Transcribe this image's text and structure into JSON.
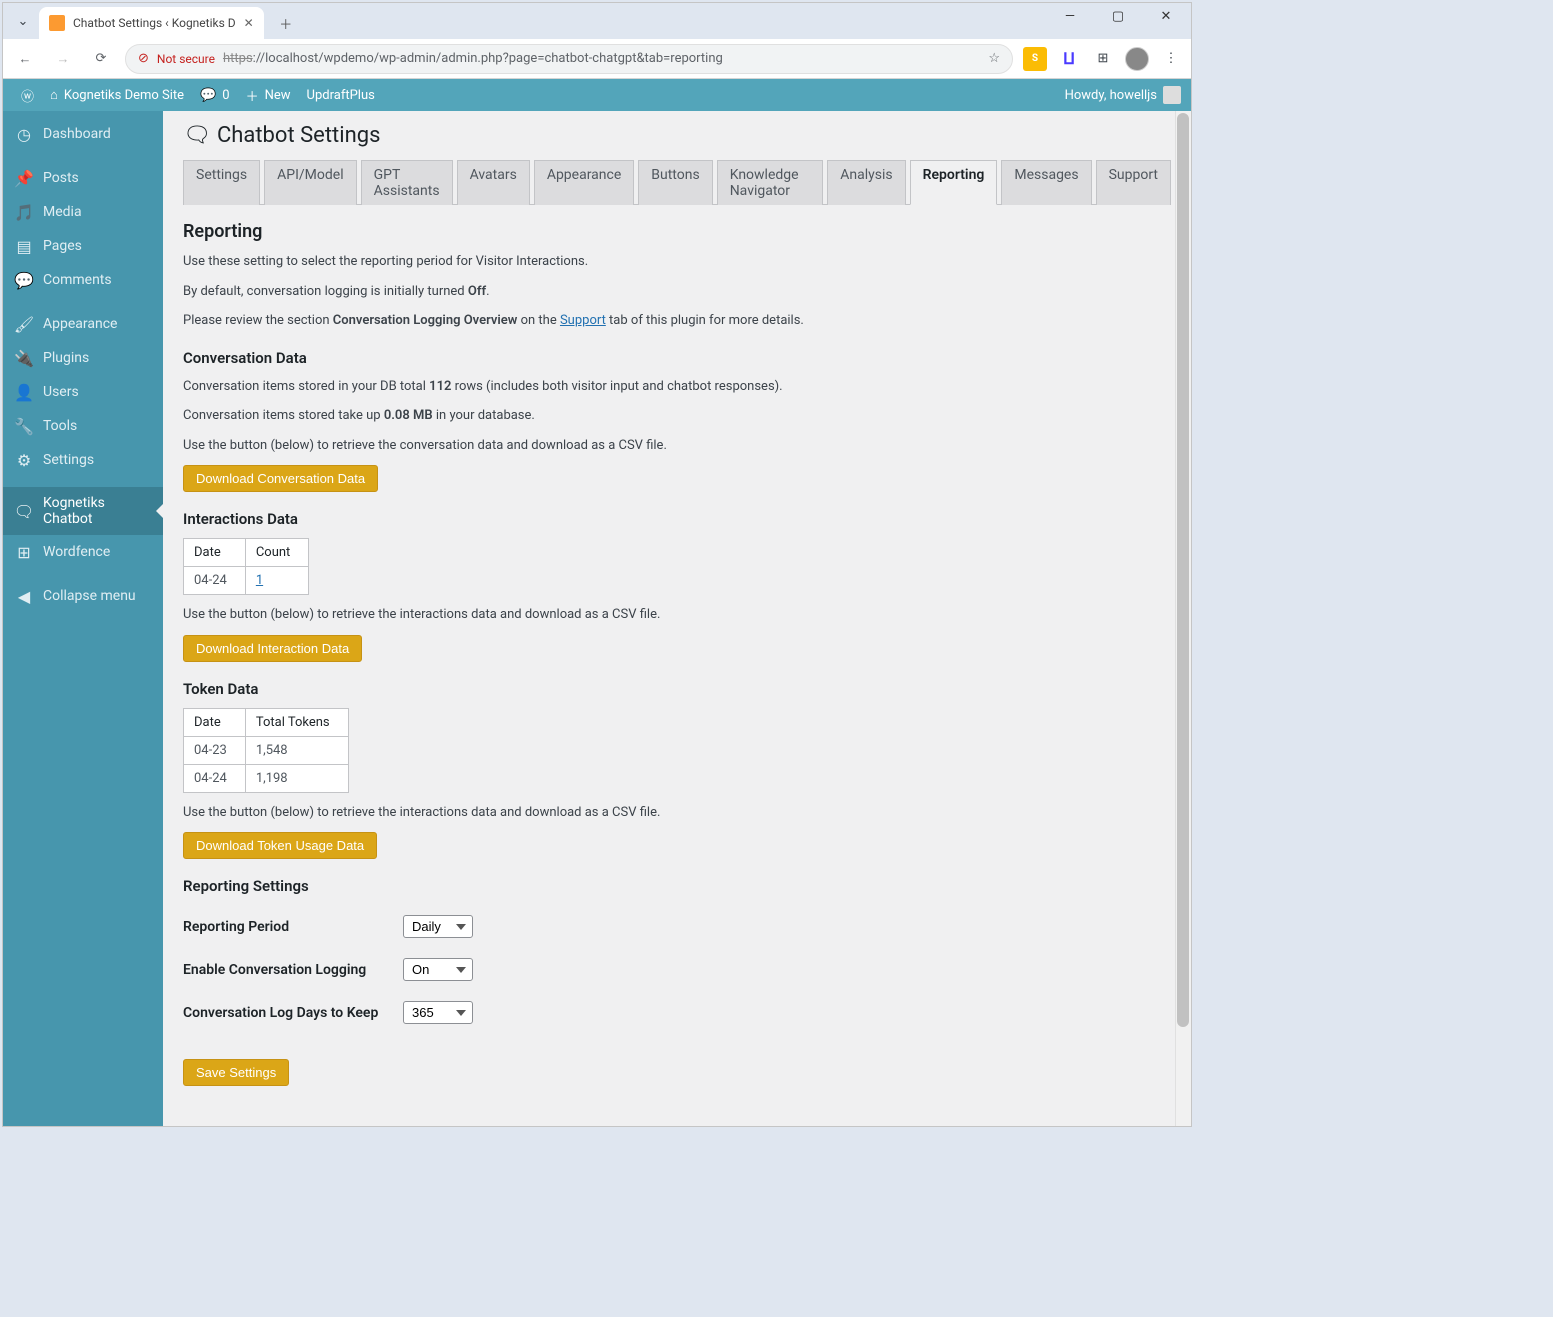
{
  "browser": {
    "tab_title": "Chatbot Settings ‹ Kognetiks D",
    "url_prefix": "https",
    "url_rest": "://localhost/wpdemo/wp-admin/admin.php?page=chatbot-chatgpt&tab=reporting",
    "not_secure": "Not secure"
  },
  "adminbar": {
    "site_name": "Kognetiks Demo Site",
    "comments": "0",
    "new": "New",
    "updraft": "UpdraftPlus",
    "howdy": "Howdy, howelljs"
  },
  "menu": {
    "dashboard": "Dashboard",
    "posts": "Posts",
    "media": "Media",
    "pages": "Pages",
    "comments": "Comments",
    "appearance": "Appearance",
    "plugins": "Plugins",
    "users": "Users",
    "tools": "Tools",
    "settings": "Settings",
    "chatbot": "Kognetiks Chatbot",
    "wordfence": "Wordfence",
    "collapse": "Collapse menu"
  },
  "page": {
    "title": "Chatbot Settings",
    "tabs": [
      "Settings",
      "API/Model",
      "GPT Assistants",
      "Avatars",
      "Appearance",
      "Buttons",
      "Knowledge Navigator",
      "Analysis",
      "Reporting",
      "Messages",
      "Support"
    ],
    "active_tab": "Reporting"
  },
  "reporting": {
    "heading": "Reporting",
    "p1": "Use these setting to select the reporting period for Visitor Interactions.",
    "p2a": "By default, conversation logging is initially turned ",
    "p2b": "Off",
    "p2c": ".",
    "p3a": "Please review the section ",
    "p3b": "Conversation Logging Overview",
    "p3c": " on the ",
    "p3d": "Support",
    "p3e": " tab of this plugin for more details."
  },
  "conv": {
    "heading": "Conversation Data",
    "p1a": "Conversation items stored in your DB total ",
    "p1b": "112",
    "p1c": " rows (includes both visitor input and chatbot responses).",
    "p2a": "Conversation items stored take up ",
    "p2b": "0.08 MB",
    "p2c": " in your database.",
    "p3": "Use the button (below) to retrieve the conversation data and download as a CSV file.",
    "btn": "Download Conversation Data"
  },
  "interactions": {
    "heading": "Interactions Data",
    "th1": "Date",
    "th2": "Count",
    "r1c1": "04-24",
    "r1c2": "1",
    "p": "Use the button (below) to retrieve the interactions data and download as a CSV file.",
    "btn": "Download Interaction Data"
  },
  "tokens": {
    "heading": "Token Data",
    "th1": "Date",
    "th2": "Total Tokens",
    "r1c1": "04-23",
    "r1c2": "1,548",
    "r2c1": "04-24",
    "r2c2": "1,198",
    "p": "Use the button (below) to retrieve the interactions data and download as a CSV file.",
    "btn": "Download Token Usage Data"
  },
  "settings": {
    "heading": "Reporting Settings",
    "period_label": "Reporting Period",
    "period_value": "Daily",
    "logging_label": "Enable Conversation Logging",
    "logging_value": "On",
    "days_label": "Conversation Log Days to Keep",
    "days_value": "365",
    "save": "Save Settings"
  }
}
